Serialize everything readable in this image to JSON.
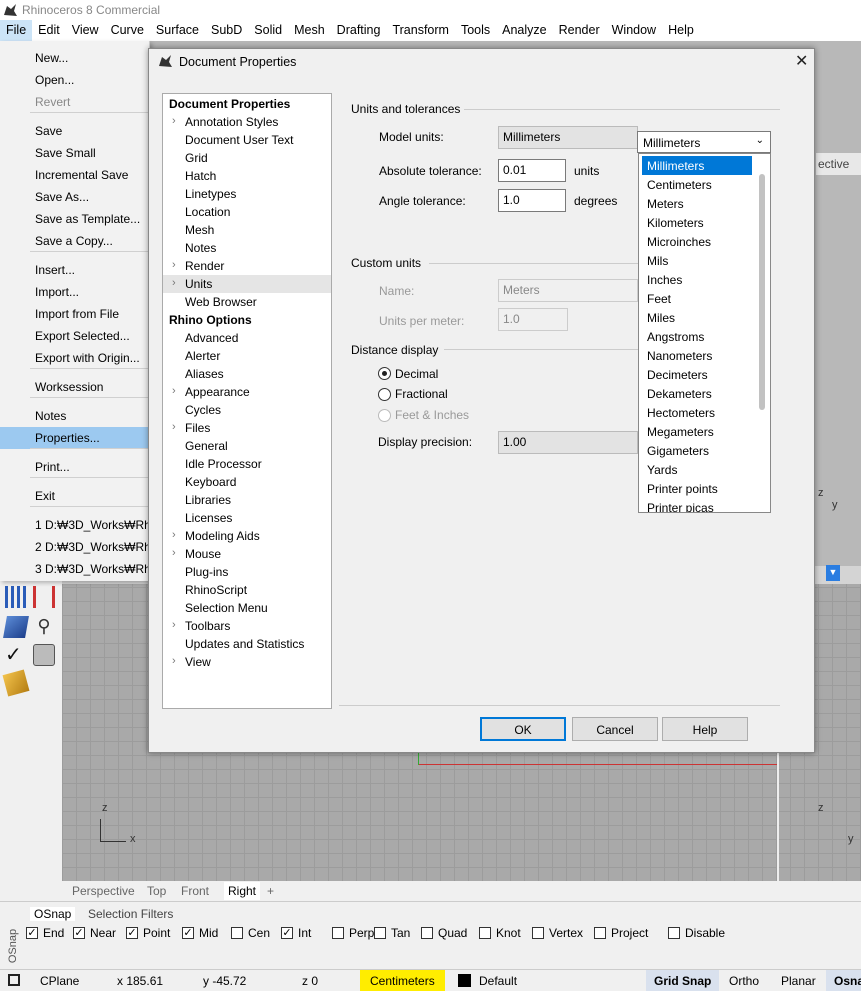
{
  "window": {
    "title": "Rhinoceros 8 Commercial"
  },
  "menubar": [
    "File",
    "Edit",
    "View",
    "Curve",
    "Surface",
    "SubD",
    "Solid",
    "Mesh",
    "Drafting",
    "Transform",
    "Tools",
    "Analyze",
    "Render",
    "Window",
    "Help"
  ],
  "file_menu": {
    "items": [
      "New...",
      "Open...",
      "Revert",
      "Save",
      "Save Small",
      "Incremental Save",
      "Save As...",
      "Save as Template...",
      "Save a Copy...",
      "Insert...",
      "Import...",
      "Import from File",
      "Export Selected...",
      "Export with Origin...",
      "Worksession",
      "Notes",
      "Properties...",
      "Print...",
      "Exit",
      "1 D:₩3D_Works₩Rhi",
      "2 D:₩3D_Works₩Rhi",
      "3 D:₩3D_Works₩Rhi"
    ],
    "selected": "Properties...",
    "disabled": [
      "Revert"
    ]
  },
  "dialog": {
    "title": "Document Properties",
    "close": "✕",
    "tree": {
      "doc_header": "Document Properties",
      "doc_items": [
        {
          "label": "Annotation Styles",
          "exp": true
        },
        {
          "label": "Document User Text",
          "exp": false
        },
        {
          "label": "Grid",
          "exp": false
        },
        {
          "label": "Hatch",
          "exp": false
        },
        {
          "label": "Linetypes",
          "exp": false
        },
        {
          "label": "Location",
          "exp": false
        },
        {
          "label": "Mesh",
          "exp": false
        },
        {
          "label": "Notes",
          "exp": false
        },
        {
          "label": "Render",
          "exp": true
        },
        {
          "label": "Units",
          "exp": true,
          "sel": true
        },
        {
          "label": "Web Browser",
          "exp": false
        }
      ],
      "rhino_header": "Rhino Options",
      "rhino_items": [
        {
          "label": "Advanced",
          "exp": false
        },
        {
          "label": "Alerter",
          "exp": false
        },
        {
          "label": "Aliases",
          "exp": false
        },
        {
          "label": "Appearance",
          "exp": true
        },
        {
          "label": "Cycles",
          "exp": false
        },
        {
          "label": "Files",
          "exp": true
        },
        {
          "label": "General",
          "exp": false
        },
        {
          "label": "Idle Processor",
          "exp": false
        },
        {
          "label": "Keyboard",
          "exp": false
        },
        {
          "label": "Libraries",
          "exp": false
        },
        {
          "label": "Licenses",
          "exp": false
        },
        {
          "label": "Modeling Aids",
          "exp": true
        },
        {
          "label": "Mouse",
          "exp": true
        },
        {
          "label": "Plug-ins",
          "exp": false
        },
        {
          "label": "RhinoScript",
          "exp": false
        },
        {
          "label": "Selection Menu",
          "exp": false
        },
        {
          "label": "Toolbars",
          "exp": true
        },
        {
          "label": "Updates and Statistics",
          "exp": false
        },
        {
          "label": "View",
          "exp": true
        }
      ]
    },
    "units": {
      "section_title": "Units and tolerances",
      "model_units_label": "Model units:",
      "model_units_value": "Millimeters",
      "abs_tol_label": "Absolute tolerance:",
      "abs_tol_value": "0.01",
      "abs_tol_unit": "units",
      "angle_tol_label": "Angle tolerance:",
      "angle_tol_value": "1.0",
      "angle_tol_unit": "degrees"
    },
    "custom": {
      "section_title": "Custom units",
      "name_label": "Name:",
      "name_value": "Meters",
      "upm_label": "Units per meter:",
      "upm_value": "1.0"
    },
    "distance": {
      "section_title": "Distance display",
      "options": [
        "Decimal",
        "Fractional",
        "Feet & Inches"
      ],
      "selected": "Decimal",
      "precision_label": "Display precision:",
      "precision_value": "1.00"
    },
    "buttons": {
      "ok": "OK",
      "cancel": "Cancel",
      "help": "Help"
    },
    "units_dropdown": {
      "current": "Millimeters",
      "options": [
        "Millimeters",
        "Centimeters",
        "Meters",
        "Kilometers",
        "Microinches",
        "Mils",
        "Inches",
        "Feet",
        "Miles",
        "Angstroms",
        "Nanometers",
        "Decimeters",
        "Dekameters",
        "Hectometers",
        "Megameters",
        "Gigameters",
        "Yards",
        "Printer points",
        "Printer picas"
      ]
    }
  },
  "viewport_tabs": [
    "Perspective",
    "Top",
    "Front",
    "Right",
    "+"
  ],
  "active_viewport": "Right",
  "viewport_label_fragment": "ective",
  "osnap": {
    "tabs": [
      "OSnap",
      "Selection Filters"
    ],
    "side_label": "OSnap",
    "items": [
      {
        "label": "End",
        "checked": true
      },
      {
        "label": "Near",
        "checked": true
      },
      {
        "label": "Point",
        "checked": true
      },
      {
        "label": "Mid",
        "checked": true
      },
      {
        "label": "Cen",
        "checked": false
      },
      {
        "label": "Int",
        "checked": true
      },
      {
        "label": "Perp",
        "checked": false
      },
      {
        "label": "Tan",
        "checked": false
      },
      {
        "label": "Quad",
        "checked": false
      },
      {
        "label": "Knot",
        "checked": false
      },
      {
        "label": "Vertex",
        "checked": false
      },
      {
        "label": "Project",
        "checked": false
      },
      {
        "label": "Disable",
        "checked": false
      }
    ]
  },
  "statusbar": {
    "cplane": "CPlane",
    "x": "x 185.61",
    "y": "y -45.72",
    "z": "z 0",
    "units": "Centimeters",
    "layer": "Default",
    "grid_snap": "Grid Snap",
    "ortho": "Ortho",
    "planar": "Planar",
    "osnap": "Osna"
  },
  "axis": {
    "z": "z",
    "x": "x",
    "y": "y"
  }
}
